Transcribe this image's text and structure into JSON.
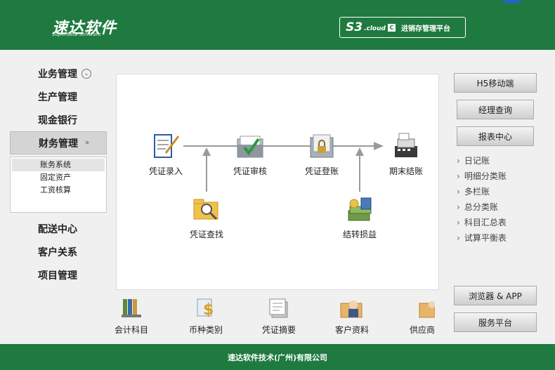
{
  "header": {
    "logo_main": "速达软件",
    "logo_sub": "Superdata Software",
    "badge_s3": "S3",
    "badge_cloud": ".cloud",
    "badge_c": "C",
    "badge_platform": "进销存管理平台"
  },
  "left_nav": {
    "items_top": [
      "业务管理",
      "生产管理",
      "现金银行"
    ],
    "active": "财务管理",
    "submenu": [
      "账务系统",
      "固定资产",
      "工资核算"
    ],
    "items_bottom": [
      "配送中心",
      "客户关系",
      "项目管理"
    ]
  },
  "flow": {
    "entry": "凭证录入",
    "audit": "凭证审核",
    "post": "凭证登账",
    "close": "期末结账",
    "search": "凭证查找",
    "transfer": "结转损益"
  },
  "right": {
    "h5": "H5移动端",
    "manager": "经理查询",
    "report": "报表中心",
    "links": [
      "日记账",
      "明细分类账",
      "多栏账",
      "总分类账",
      "科目汇总表",
      "试算平衡表"
    ],
    "browser_app": "浏览器 & APP",
    "service": "服务平台"
  },
  "bottom_icons": [
    "会计科目",
    "币种类别",
    "凭证摘要",
    "客户资料",
    "供应商"
  ],
  "footer": {
    "company": "速达软件技术(广州)有限公司"
  },
  "colors": {
    "brand_green": "#1f7a3f",
    "panel_bg": "#ffffff",
    "page_bg": "#f0f0f0"
  }
}
